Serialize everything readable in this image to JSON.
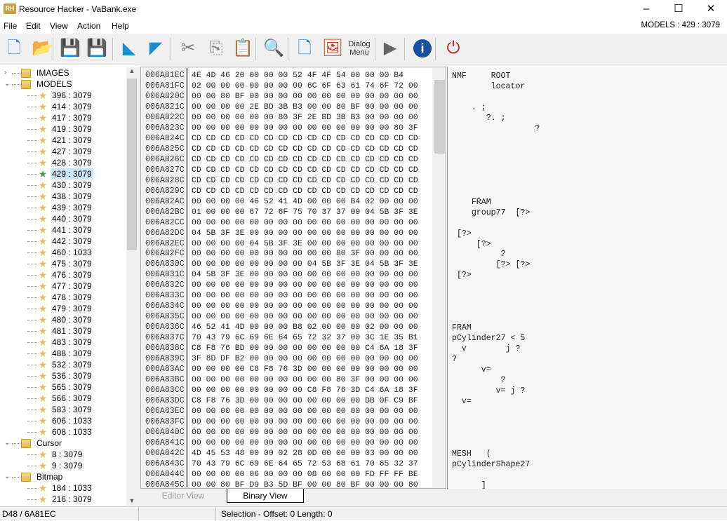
{
  "window": {
    "title": "Resource Hacker - VaBank.exe",
    "logo": "RH",
    "minimize": "–",
    "maximize": "☐",
    "close": "✕"
  },
  "menu": [
    "File",
    "Edit",
    "View",
    "Action",
    "Help"
  ],
  "selected_resource": "MODELS : 429 : 3079",
  "toolbar": [
    {
      "name": "new-file-icon",
      "glyph": "🗋"
    },
    {
      "name": "open-folder-icon",
      "glyph": "📂"
    },
    {
      "name": "save-icon",
      "glyph": "💾"
    },
    {
      "name": "save-as-icon",
      "glyph": "💾"
    },
    {
      "name": "compile-icon",
      "glyph": "◣"
    },
    {
      "name": "compile-arrow-icon",
      "glyph": "◤"
    },
    {
      "name": "cut-icon",
      "glyph": "✂"
    },
    {
      "name": "copy-icon",
      "glyph": "⎘"
    },
    {
      "name": "paste-icon",
      "glyph": "📋"
    },
    {
      "name": "search-icon",
      "glyph": "🔍"
    },
    {
      "name": "add-resource-icon",
      "glyph": "🗋"
    },
    {
      "name": "add-image-icon",
      "glyph": "🖼"
    },
    {
      "name": "add-dialog-menu-icon",
      "glyph": "Dialog Menu"
    },
    {
      "name": "run-icon",
      "glyph": "▶"
    },
    {
      "name": "info-icon",
      "glyph": "i"
    },
    {
      "name": "exit-icon",
      "glyph": "⏻"
    }
  ],
  "tree": {
    "groups": [
      {
        "label": "IMAGES",
        "expanded": false,
        "items": []
      },
      {
        "label": "MODELS",
        "expanded": true,
        "items": [
          "396 : 3079",
          "414 : 3079",
          "417 : 3079",
          "419 : 3079",
          "421 : 3079",
          "427 : 3079",
          "428 : 3079",
          "429 : 3079",
          "430 : 3079",
          "438 : 3079",
          "439 : 3079",
          "440 : 3079",
          "441 : 3079",
          "442 : 3079",
          "460 : 1033",
          "475 : 3079",
          "476 : 3079",
          "477 : 3079",
          "478 : 3079",
          "479 : 3079",
          "480 : 3079",
          "481 : 3079",
          "483 : 3079",
          "488 : 3079",
          "532 : 3079",
          "536 : 3079",
          "565 : 3079",
          "566 : 3079",
          "583 : 3079",
          "606 : 1033",
          "608 : 1033"
        ]
      },
      {
        "label": "Cursor",
        "expanded": true,
        "items": [
          "8 : 3079",
          "9 : 3079"
        ]
      },
      {
        "label": "Bitmap",
        "expanded": true,
        "items": [
          "184 : 1033",
          "216 : 3079"
        ]
      }
    ],
    "selected": "429 : 3079"
  },
  "hex": {
    "offsets": [
      "006A81EC",
      "006A81FC",
      "006A820C",
      "006A821C",
      "006A822C",
      "006A823C",
      "006A824C",
      "006A825C",
      "006A826C",
      "006A827C",
      "006A828C",
      "006A829C",
      "006A82AC",
      "006A82BC",
      "006A82CC",
      "006A82DC",
      "006A82EC",
      "006A82FC",
      "006A830C",
      "006A831C",
      "006A832C",
      "006A833C",
      "006A834C",
      "006A835C",
      "006A836C",
      "006A837C",
      "006A838C",
      "006A839C",
      "006A83AC",
      "006A83BC",
      "006A83CC",
      "006A83DC",
      "006A83EC",
      "006A83FC",
      "006A840C",
      "006A841C",
      "006A842C",
      "006A843C",
      "006A844C",
      "006A845C"
    ],
    "rows": [
      "4E 4D 46 20 00 00 00 52 4F 4F 54 00 00 00 B4",
      "02 00 00 00 00 00 00 00 6C 6F 63 61 74 6F 72 00",
      "00 00 80 BF 00 00 00 00 00 00 00 00 00 00 00 00",
      "00 00 00 00 2E BD 3B B3 00 00 80 BF 00 00 00 00",
      "00 00 00 00 00 00 80 3F 2E BD 3B B3 00 00 00 00",
      "00 00 00 00 00 00 00 00 00 00 00 00 00 00 80 3F",
      "CD CD CD CD CD CD CD CD CD CD CD CD CD CD CD CD",
      "CD CD CD CD CD CD CD CD CD CD CD CD CD CD CD CD",
      "CD CD CD CD CD CD CD CD CD CD CD CD CD CD CD CD",
      "CD CD CD CD CD CD CD CD CD CD CD CD CD CD CD CD",
      "CD CD CD CD CD CD CD CD CD CD CD CD CD CD CD CD",
      "CD CD CD CD CD CD CD CD CD CD CD CD CD CD CD CD",
      "00 00 00 00 46 52 41 4D 00 00 00 B4 02 00 00 00",
      "01 00 00 00 67 72 6F 75 70 37 37 00 04 5B 3F 3E",
      "00 00 00 00 00 00 00 00 00 00 00 00 00 00 00 00",
      "04 5B 3F 3E 00 00 00 00 00 00 00 00 00 00 00 00",
      "00 00 00 00 04 5B 3F 3E 00 00 00 00 00 00 00 00",
      "00 00 00 00 00 00 00 00 00 00 80 3F 00 00 00 00",
      "00 00 00 00 00 00 00 00 04 5B 3F 3E 04 5B 3F 3E",
      "04 5B 3F 3E 00 00 00 00 00 00 00 00 00 00 00 00",
      "00 00 00 00 00 00 00 00 00 00 00 00 00 00 00 00",
      "00 00 00 00 00 00 00 00 00 00 00 00 00 00 00 00",
      "00 00 00 00 00 00 00 00 00 00 00 00 00 00 00 00",
      "00 00 00 00 00 00 00 00 00 00 00 00 00 00 00 00",
      "46 52 41 4D 00 00 00 B8 02 00 00 00 02 00 00 00",
      "70 43 79 6C 69 6E 64 65 72 32 37 00 3C 1E 35 B1",
      "C8 F8 76 BD 00 00 00 00 00 00 00 00 C4 6A 18 3F",
      "3F 8D DF B2 00 00 00 00 00 00 00 00 00 00 00 00",
      "00 00 00 00 C8 F8 76 3D 00 00 00 00 00 00 00 00",
      "00 00 00 00 00 00 00 00 00 00 80 3F 00 00 00 00",
      "00 00 00 00 00 00 00 00 C8 F8 76 3D C4 6A 18 3F",
      "C8 F8 76 3D 00 00 00 00 00 00 00 00 DB 0F C9 BF",
      "00 00 00 00 00 00 00 00 00 00 00 00 00 00 00 00",
      "00 00 00 00 00 00 00 00 00 00 00 00 00 00 00 00",
      "00 00 00 00 00 00 00 00 00 00 00 00 00 00 00 00",
      "00 00 00 00 00 00 00 00 00 00 00 00 00 00 00 00",
      "4D 45 53 48 00 00 02 28 0D 00 00 00 03 00 00 00",
      "70 43 79 6C 69 6E 64 65 72 53 68 61 70 65 32 37",
      "00 00 00 00 06 00 00 00 08 00 00 00 FD FF FF BE",
      "00 00 80 BF D9 B3 5D BF 00 00 80 BF 00 00 00 80"
    ],
    "text": [
      "NMF     ROOT",
      "        locator",
      "",
      "    . ;",
      "       ?. ;",
      "                 ?",
      "",
      "",
      "",
      "",
      "",
      "",
      "    FRAM",
      "    group77  [?>",
      "",
      " [?>",
      "     [?>",
      "          ?",
      "         [?> [?>",
      " [?>",
      "",
      "",
      "",
      "",
      "FRAM",
      "pCylinder27 < 5",
      "  v        j ?",
      "?",
      "      v=",
      "          ?",
      "         v= j ?",
      "  v=",
      "",
      "",
      "",
      "",
      "MESH   (",
      "pCylinderShape27",
      "",
      "      ]"
    ]
  },
  "tabs": {
    "editor": "Editor View",
    "binary": "Binary View"
  },
  "status": {
    "left": "D48 / 6A81EC",
    "right": "Selection - Offset: 0 Length: 0"
  }
}
